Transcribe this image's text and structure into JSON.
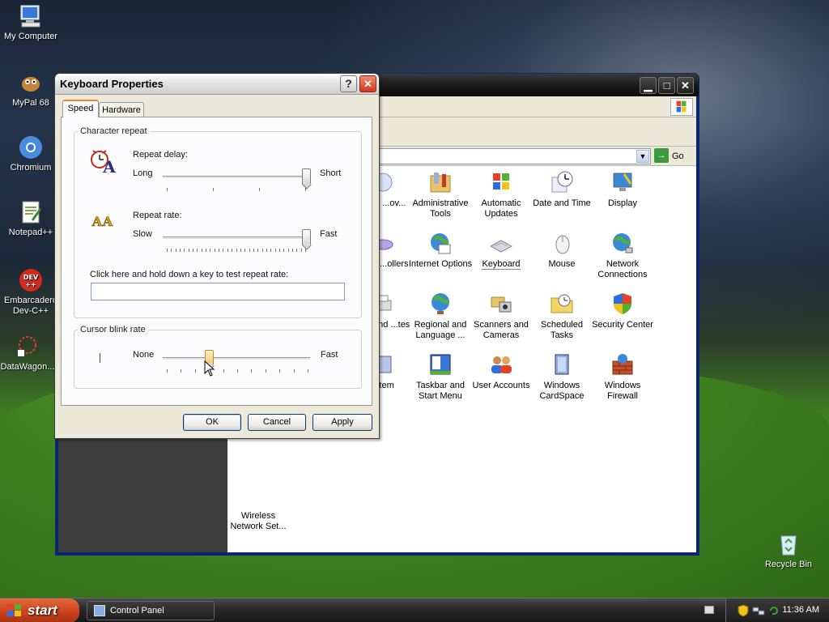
{
  "desktop": {
    "icons": [
      {
        "label": "My Computer"
      },
      {
        "label": "MyPal 68"
      },
      {
        "label": "Chromium"
      },
      {
        "label": "Notepad++"
      },
      {
        "label": "Embarcadero Dev-C++"
      },
      {
        "label": "DataWagon..."
      },
      {
        "label": "Recycle Bin"
      }
    ]
  },
  "control_panel": {
    "go_label": "Go",
    "items": [
      {
        "label": "...l or ...ov...",
        "icon": "add-remove-programs-icon"
      },
      {
        "label": "Administrative Tools",
        "icon": "admin-tools-icon"
      },
      {
        "label": "Automatic Updates",
        "icon": "windows-update-icon"
      },
      {
        "label": "Date and Time",
        "icon": "clock-icon"
      },
      {
        "label": "Display",
        "icon": "display-icon"
      },
      {
        "label": "...me ...ollers",
        "icon": "game-controller-icon"
      },
      {
        "label": "Internet Options",
        "icon": "globe-icon"
      },
      {
        "label": "Keyboard",
        "icon": "keyboard-icon"
      },
      {
        "label": "Mouse",
        "icon": "mouse-icon"
      },
      {
        "label": "Network Connections",
        "icon": "network-icon"
      },
      {
        "label": "...rs and ...tes",
        "icon": "printer-icon"
      },
      {
        "label": "Regional and Language ...",
        "icon": "globe-icon"
      },
      {
        "label": "Scanners and Cameras",
        "icon": "scanner-icon"
      },
      {
        "label": "Scheduled Tasks",
        "icon": "folder-clock-icon"
      },
      {
        "label": "Security Center",
        "icon": "shield-icon"
      },
      {
        "label": "...tem",
        "icon": "system-icon"
      },
      {
        "label": "Taskbar and Start Menu",
        "icon": "taskbar-icon"
      },
      {
        "label": "User Accounts",
        "icon": "users-icon"
      },
      {
        "label": "Windows CardSpace",
        "icon": "cardspace-icon"
      },
      {
        "label": "Windows Firewall",
        "icon": "firewall-icon"
      },
      {
        "label": "Wireless Network Set...",
        "icon": "wireless-icon"
      }
    ]
  },
  "dialog": {
    "title": "Keyboard Properties",
    "help": "?",
    "close": "✕",
    "tabs": {
      "speed": "Speed",
      "hardware": "Hardware"
    },
    "char_repeat": {
      "group_label": "Character repeat",
      "delay_label": "Repeat delay:",
      "delay_min": "Long",
      "delay_max": "Short",
      "delay_value_pct": 100,
      "rate_label": "Repeat rate:",
      "rate_min": "Slow",
      "rate_max": "Fast",
      "rate_value_pct": 100,
      "test_label": "Click here and hold down a key to test repeat rate:",
      "test_value": ""
    },
    "cursor_blink": {
      "group_label": "Cursor blink rate",
      "min": "None",
      "max": "Fast",
      "value_pct": 30
    },
    "buttons": {
      "ok": "OK",
      "cancel": "Cancel",
      "apply": "Apply"
    }
  },
  "taskbar": {
    "start_label": "start",
    "task_label": "Control Panel",
    "clock": "11:36 AM"
  }
}
